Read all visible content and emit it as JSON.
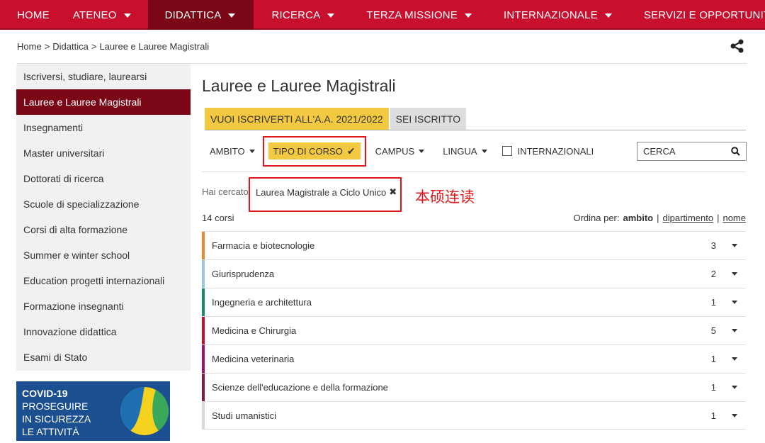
{
  "nav": {
    "items": [
      {
        "label": "HOME",
        "dropdown": false,
        "active": false
      },
      {
        "label": "ATENEO",
        "dropdown": true,
        "active": false
      },
      {
        "label": "DIDATTICA",
        "dropdown": true,
        "active": true
      },
      {
        "label": "RICERCA",
        "dropdown": true,
        "active": false
      },
      {
        "label": "TERZA MISSIONE",
        "dropdown": true,
        "active": false
      },
      {
        "label": "INTERNAZIONALE",
        "dropdown": true,
        "active": false
      },
      {
        "label": "SERVIZI E OPPORTUNITÀ",
        "dropdown": true,
        "active": false
      }
    ]
  },
  "breadcrumb": [
    "Home",
    "Didattica",
    "Lauree e Lauree Magistrali"
  ],
  "breadcrumb_sep": ">",
  "share_icon": "share-icon",
  "sidebar": {
    "items": [
      {
        "label": "Iscriversi, studiare, laurearsi",
        "active": false
      },
      {
        "label": "Lauree e Lauree Magistrali",
        "active": true
      },
      {
        "label": "Insegnamenti",
        "active": false
      },
      {
        "label": "Master universitari",
        "active": false
      },
      {
        "label": "Dottorati di ricerca",
        "active": false
      },
      {
        "label": "Scuole di specializzazione",
        "active": false
      },
      {
        "label": "Corsi di alta formazione",
        "active": false
      },
      {
        "label": "Summer e winter school",
        "active": false
      },
      {
        "label": "Education progetti internazionali",
        "active": false
      },
      {
        "label": "Formazione insegnanti",
        "active": false
      },
      {
        "label": "Innovazione didattica",
        "active": false
      },
      {
        "label": "Esami di Stato",
        "active": false
      }
    ]
  },
  "covid_banner": {
    "line1": "COVID-19",
    "line2": "PROSEGUIRE",
    "line3": "IN SICUREZZA",
    "line4": "LE ATTIVITÀ"
  },
  "main": {
    "title": "Lauree e Lauree Magistrali",
    "tabs": [
      {
        "label": "VUOI ISCRIVERTI ALL'A.A. 2021/2022",
        "active": true
      },
      {
        "label": "SEI ISCRITTO",
        "active": false
      }
    ],
    "filters": {
      "ambito": "AMBITO",
      "tipo": "TIPO DI CORSO",
      "campus": "CAMPUS",
      "lingua": "LINGUA",
      "internazionali": "INTERNAZIONALI"
    },
    "search_label": "CERCA",
    "searched_label": "Hai cercato:",
    "chip_label": "Laurea Magistrale a Ciclo Unico",
    "annotation": "本硕连读",
    "count": "14 corsi",
    "sort": {
      "label": "Ordina per:",
      "ambito": "ambito",
      "dipartimento": "dipartimento",
      "nome": "nome",
      "sep": "|"
    },
    "rows": [
      {
        "name": "Farmacia e biotecnologie",
        "count": "3",
        "color": "#e8892e"
      },
      {
        "name": "Giurisprudenza",
        "count": "2",
        "color": "#9cc5e3"
      },
      {
        "name": "Ingegneria e architettura",
        "count": "1",
        "color": "#1a8a6e"
      },
      {
        "name": "Medicina e Chirurgia",
        "count": "5",
        "color": "#c8102e"
      },
      {
        "name": "Medicina veterinaria",
        "count": "1",
        "color": "#a0126a"
      },
      {
        "name": "Scienze dell'educazione e della formazione",
        "count": "1",
        "color": "#8a1a3a"
      },
      {
        "name": "Studi umanistici",
        "count": "1",
        "color": "#d8d8d8"
      }
    ]
  },
  "colors": {
    "nav_bg": "#c8102e",
    "nav_active": "#7a0616",
    "accent_yellow": "#f3c941",
    "highlight_red": "#e0161b"
  }
}
